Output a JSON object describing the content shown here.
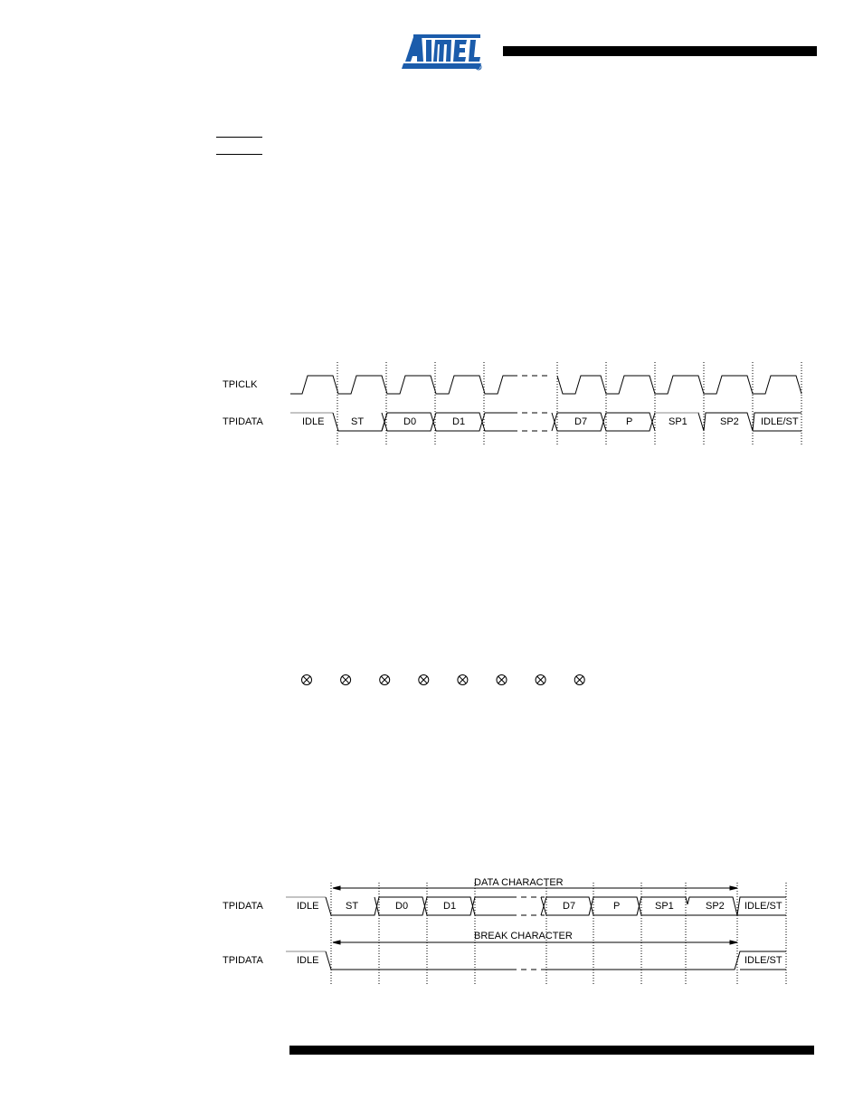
{
  "header": {
    "brand": "ATMEL",
    "brand_color": "#1b5cab",
    "registered_mark": "®"
  },
  "figure1": {
    "signals": {
      "clock": "TPICLK",
      "data": "TPIDATA"
    },
    "frame_bits": [
      "IDLE",
      "ST",
      "D0",
      "D1",
      "",
      "D7",
      "P",
      "SP1",
      "SP2",
      "IDLE/ST"
    ]
  },
  "parity_row": {
    "symbol": "⊗",
    "count": 8
  },
  "figure2": {
    "row1": {
      "signal": "TPIDATA",
      "span_label": "DATA CHARACTER",
      "bits": [
        "IDLE",
        "ST",
        "D0",
        "D1",
        "",
        "D7",
        "P",
        "SP1",
        "SP2",
        "IDLE/ST"
      ]
    },
    "row2": {
      "signal": "TPIDATA",
      "span_label": "BREAK CHARACTER",
      "start_label": "IDLE",
      "end_label": "IDLE/ST"
    }
  }
}
